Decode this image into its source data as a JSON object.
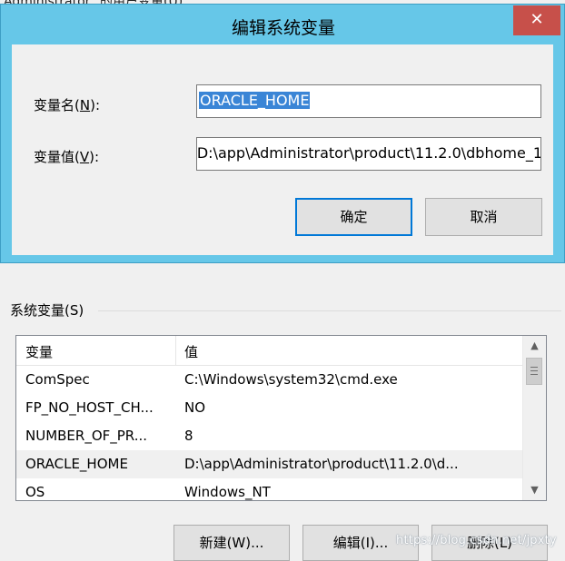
{
  "background_window": {
    "title_left": "Administrator",
    "title_right": "的用户变量(U)",
    "group_label": "系统变量(S)",
    "columns": [
      "变量",
      "值"
    ],
    "rows": [
      {
        "name": "ComSpec",
        "value": "C:\\Windows\\system32\\cmd.exe"
      },
      {
        "name": "FP_NO_HOST_CH...",
        "value": "NO"
      },
      {
        "name": "NUMBER_OF_PR...",
        "value": "8"
      },
      {
        "name": "ORACLE_HOME",
        "value": "D:\\app\\Administrator\\product\\11.2.0\\d..."
      },
      {
        "name": "OS",
        "value": "Windows_NT"
      }
    ],
    "selected_row": 3,
    "buttons": {
      "new": "新建(W)...",
      "edit": "编辑(I)...",
      "delete": "删除(L)"
    },
    "watermark": "https://blog.csdn.net/jpxty"
  },
  "dialog": {
    "title": "编辑系统变量",
    "close_glyph": "✕",
    "name_label": "变量名",
    "name_key": "N",
    "name_label_tail": "):",
    "name_value": "ORACLE_HOME",
    "value_label": "变量值",
    "value_key": "V",
    "value_label_tail": "):",
    "value_value": "D:\\app\\Administrator\\product\\11.2.0\\dbhome_1",
    "ok": "确定",
    "cancel": "取消"
  },
  "colors": {
    "titlebar": "#66c7e8",
    "close": "#c7504a",
    "selection": "#3a85d6"
  }
}
